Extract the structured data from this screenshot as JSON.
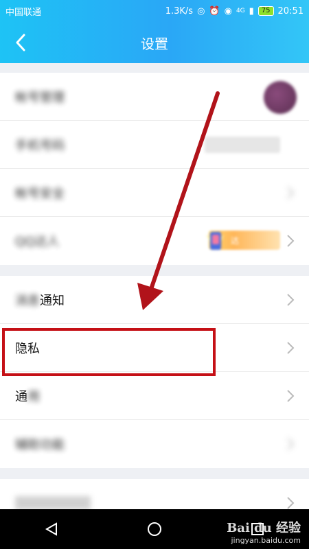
{
  "status": {
    "carrier": "中国联通",
    "speed": "1.3K/s",
    "battery": "75",
    "time": "20:51",
    "network": "4G"
  },
  "header": {
    "title": "设置"
  },
  "groups": [
    {
      "rows": [
        {
          "label": "帐号管理",
          "blurred": true
        },
        {
          "label": "手机号码",
          "blurred": true
        },
        {
          "label": "帐号安全",
          "blurred": true
        },
        {
          "label": "QQ达人",
          "blurred": true,
          "badge_text": "达"
        }
      ]
    },
    {
      "rows": [
        {
          "label": "消息通知",
          "label_visible": "通知"
        },
        {
          "label": "隐私"
        },
        {
          "label": "通用",
          "label_visible": "通"
        },
        {
          "label": "辅助功能",
          "blurred": true
        }
      ]
    }
  ],
  "annotation": {
    "highlight_color": "#c51016"
  },
  "watermark": {
    "brand": "Bai du 经验",
    "url": "jingyan.baidu.com"
  },
  "icons": [
    "back-icon",
    "chevron-right-icon",
    "nav-back-icon",
    "nav-home-icon",
    "nav-recent-icon"
  ]
}
